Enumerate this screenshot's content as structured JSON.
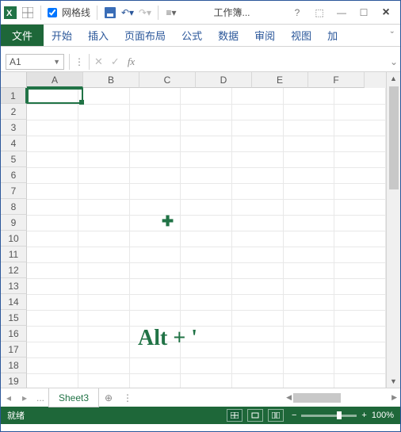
{
  "titlebar": {
    "gridlines_label": "网格线",
    "doc_title": "工作簿...",
    "help": "?"
  },
  "ribbon": {
    "file": "文件",
    "tabs": [
      "开始",
      "插入",
      "页面布局",
      "公式",
      "数据",
      "审阅",
      "视图",
      "加"
    ]
  },
  "formula": {
    "namebox": "A1",
    "fx": "fx"
  },
  "grid": {
    "cols": [
      "A",
      "B",
      "C",
      "D",
      "E",
      "F"
    ],
    "rows": [
      "1",
      "2",
      "3",
      "4",
      "5",
      "6",
      "7",
      "8",
      "9",
      "10",
      "11",
      "12",
      "13",
      "14",
      "15",
      "16",
      "17",
      "18",
      "19"
    ]
  },
  "overlay": {
    "text": "Alt + '"
  },
  "sheets": {
    "more": "...",
    "active": "Sheet3",
    "add": "⊕"
  },
  "status": {
    "ready": "就绪",
    "zoom": "100%"
  },
  "chart_data": {
    "type": "table",
    "cols": [
      "A",
      "B",
      "C",
      "D",
      "E",
      "F"
    ],
    "rows": 19,
    "values": []
  }
}
